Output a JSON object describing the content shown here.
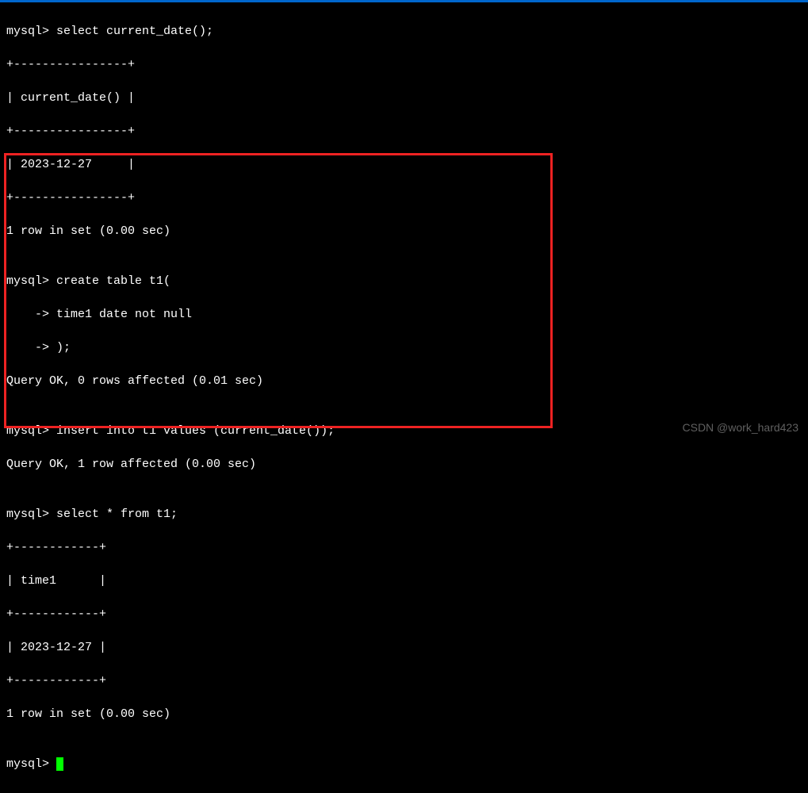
{
  "terminal": {
    "lines": {
      "l1": "mysql> select current_date();",
      "l2": "+----------------+",
      "l3": "| current_date() |",
      "l4": "+----------------+",
      "l5": "| 2023-12-27     |",
      "l6": "+----------------+",
      "l7": "1 row in set (0.00 sec)",
      "l8": "",
      "l9": "mysql> create table t1(",
      "l10": "    -> time1 date not null",
      "l11": "    -> );",
      "l12": "Query OK, 0 rows affected (0.01 sec)",
      "l13": "",
      "l14": "mysql> insert into t1 values (current_date());",
      "l15": "Query OK, 1 row affected (0.00 sec)",
      "l16": "",
      "l17": "mysql> select * from t1;",
      "l18": "+------------+",
      "l19": "| time1      |",
      "l20": "+------------+",
      "l21": "| 2023-12-27 |",
      "l22": "+------------+",
      "l23": "1 row in set (0.00 sec)",
      "l24": "",
      "l25": "mysql> "
    }
  },
  "watermark": "CSDN @work_hard423"
}
